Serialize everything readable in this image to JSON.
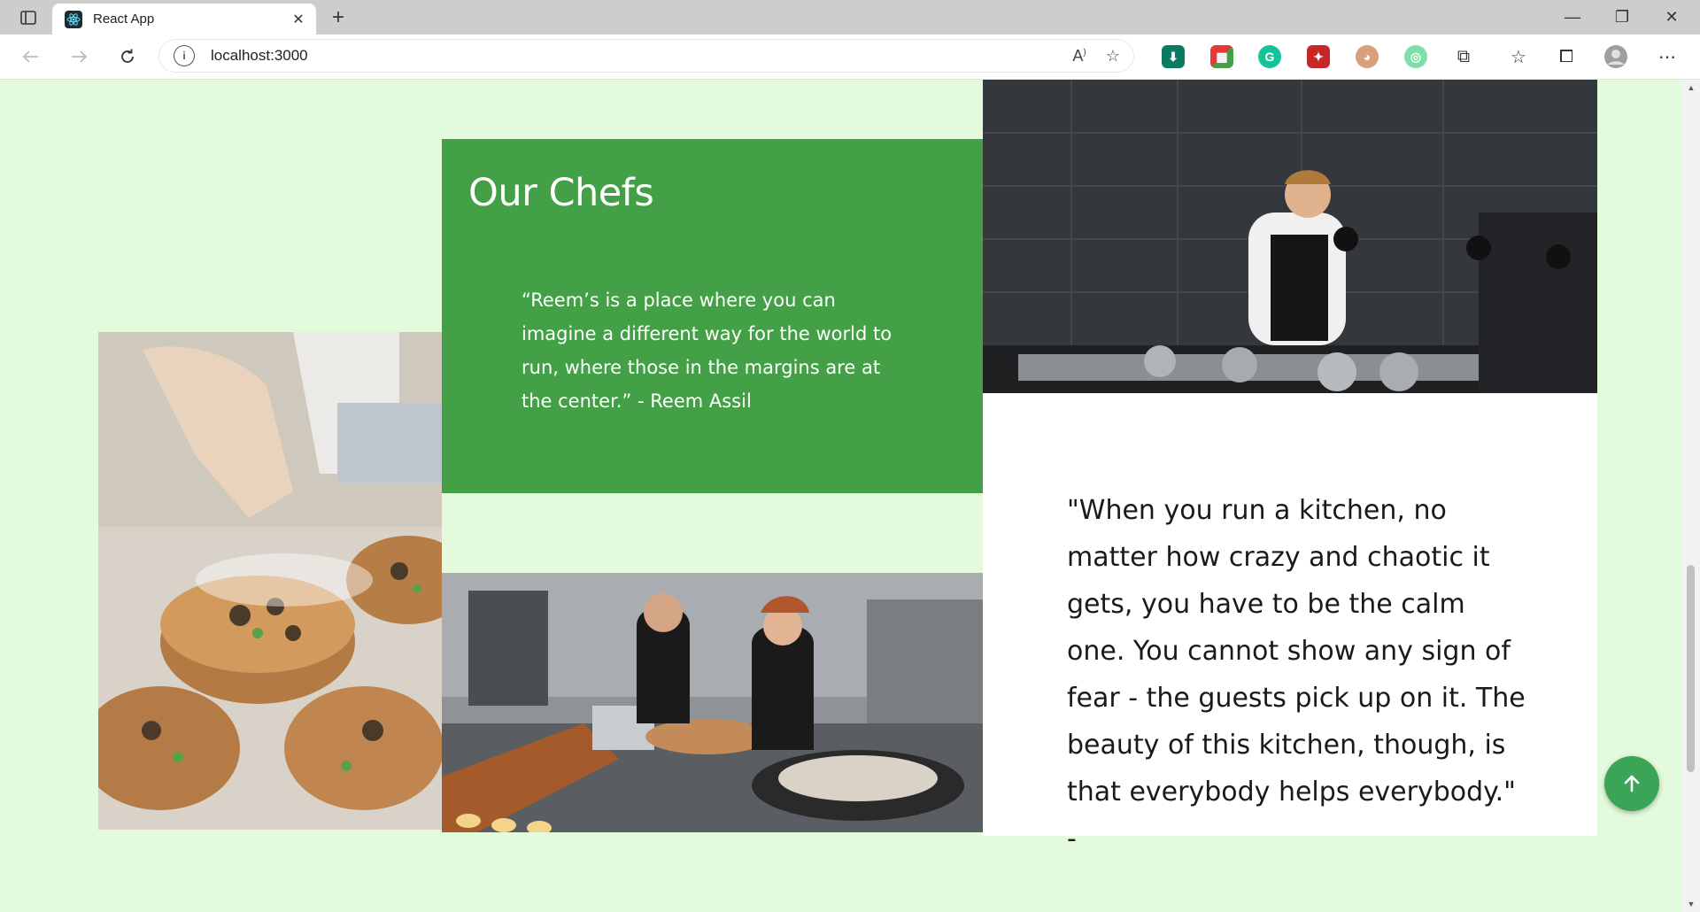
{
  "browser": {
    "tab_title": "React App",
    "tab_close": "✕",
    "new_tab": "+",
    "url": "localhost:3000",
    "window_controls": {
      "minimize": "—",
      "restore": "❐",
      "close": "✕"
    }
  },
  "section": {
    "heading": "Our Chefs",
    "quote_reem": "“Reem’s is a place where you can imagine a different way for the world to run, where those in the margins are at the center.” - Reem Assil",
    "quote_kitchen": "\"When you run a kitchen, no matter how crazy and chaotic it gets, you have to be the calm one. You cannot show any sign of fear - the guests pick up on it. The beauty of this kitchen, though, is that everybody helps everybody.\" -"
  },
  "icons": {
    "back": "back-arrow-icon",
    "forward": "forward-arrow-icon",
    "refresh": "refresh-icon",
    "scroll_top": "arrow-up-icon"
  },
  "colors": {
    "page_bg": "#e3fbdc",
    "card_green": "#43a046",
    "fab_green": "#3aa556"
  }
}
